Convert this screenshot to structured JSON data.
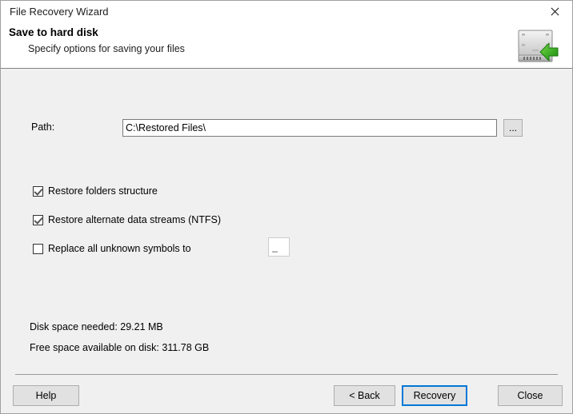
{
  "window": {
    "title": "File Recovery Wizard",
    "close_icon": "close-x-icon"
  },
  "header": {
    "title": "Save to hard disk",
    "subtitle": "Specify options for saving your files",
    "icon": "hard-disk-with-green-arrow-icon"
  },
  "form": {
    "path": {
      "label": "Path:",
      "value": "C:\\Restored Files\\",
      "placeholder": "",
      "browse_label": "..."
    },
    "checkboxes": [
      {
        "label": "Restore folders structure",
        "checked": true
      },
      {
        "label": "Restore alternate data streams (NTFS)",
        "checked": true
      },
      {
        "label": "Replace all unknown symbols to",
        "checked": false
      }
    ],
    "replace_char": {
      "value": "_",
      "placeholder": ""
    }
  },
  "status": {
    "space_needed": "Disk space needed: 29.21 MB",
    "space_free": "Free space available on disk: 311.78 GB"
  },
  "footer": {
    "help_label": "Help",
    "back_label": "< Back",
    "recovery_label": "Recovery",
    "close_label": "Close"
  },
  "colors": {
    "accent": "#0078d7",
    "window_bg": "#f0f0f0",
    "header_bg": "#ffffff",
    "button_face": "#e1e1e1",
    "icon_green": "#3db02a"
  }
}
